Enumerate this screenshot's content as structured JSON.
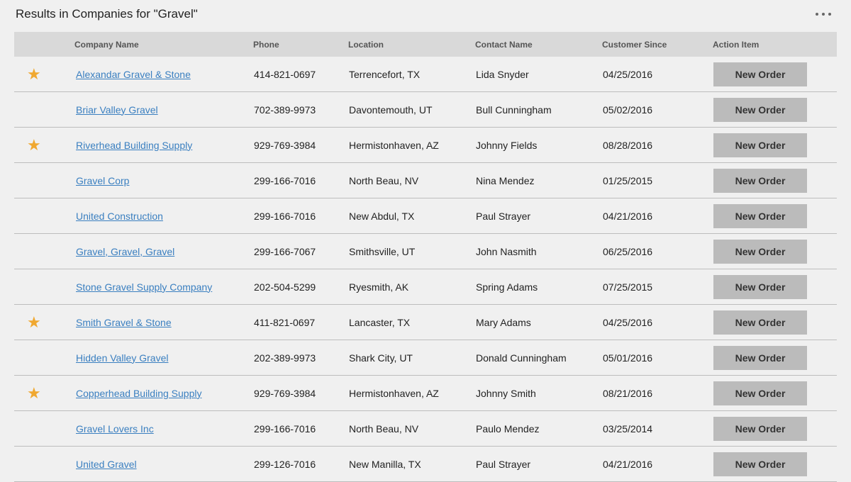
{
  "header": {
    "title": "Results in Companies for \"Gravel\""
  },
  "table": {
    "columns": [
      "",
      "Company Name",
      "Phone",
      "Location",
      "Contact Name",
      "Customer Since",
      "Action Item"
    ],
    "rows": [
      {
        "starred": true,
        "star": "★",
        "name": "Alexandar Gravel & Stone",
        "phone": "414-821-0697",
        "location": "Terrencefort, TX",
        "contact": "Lida Snyder",
        "since": "04/25/2016",
        "action": "New Order"
      },
      {
        "starred": false,
        "star": "",
        "name": "Briar Valley Gravel",
        "phone": "702-389-9973",
        "location": "Davontemouth, UT",
        "contact": "Bull Cunningham",
        "since": "05/02/2016",
        "action": "New Order"
      },
      {
        "starred": true,
        "star": "★",
        "name": "Riverhead Building Supply",
        "phone": "929-769-3984",
        "location": "Hermistonhaven, AZ",
        "contact": "Johnny Fields",
        "since": "08/28/2016",
        "action": "New Order"
      },
      {
        "starred": false,
        "star": "",
        "name": "Gravel Corp",
        "phone": "299-166-7016",
        "location": "North Beau, NV",
        "contact": "Nina Mendez",
        "since": "01/25/2015",
        "action": "New Order"
      },
      {
        "starred": false,
        "star": "",
        "name": "United Construction",
        "phone": "299-166-7016",
        "location": "New Abdul, TX",
        "contact": "Paul Strayer",
        "since": "04/21/2016",
        "action": "New Order"
      },
      {
        "starred": false,
        "star": "",
        "name": "Gravel, Gravel, Gravel",
        "phone": "299-166-7067",
        "location": "Smithsville, UT",
        "contact": "John Nasmith",
        "since": "06/25/2016",
        "action": "New Order"
      },
      {
        "starred": false,
        "star": "",
        "name": "Stone Gravel Supply Company",
        "phone": "202-504-5299",
        "location": "Ryesmith, AK",
        "contact": "Spring Adams",
        "since": "07/25/2015",
        "action": "New Order"
      },
      {
        "starred": true,
        "star": "★",
        "name": "Smith Gravel & Stone",
        "phone": "411-821-0697",
        "location": "Lancaster, TX",
        "contact": "Mary Adams",
        "since": "04/25/2016",
        "action": "New Order"
      },
      {
        "starred": false,
        "star": "",
        "name": "Hidden Valley Gravel",
        "phone": "202-389-9973",
        "location": "Shark City, UT",
        "contact": "Donald Cunningham",
        "since": "05/01/2016",
        "action": "New Order"
      },
      {
        "starred": true,
        "star": "★",
        "name": "Copperhead Building Supply",
        "phone": "929-769-3984",
        "location": "Hermistonhaven, AZ",
        "contact": "Johnny Smith",
        "since": "08/21/2016",
        "action": "New Order"
      },
      {
        "starred": false,
        "star": "",
        "name": "Gravel Lovers Inc",
        "phone": "299-166-7016",
        "location": "North Beau, NV",
        "contact": "Paulo Mendez",
        "since": "03/25/2014",
        "action": "New Order"
      },
      {
        "starred": false,
        "star": "",
        "name": "United Gravel",
        "phone": "299-126-7016",
        "location": "New Manilla, TX",
        "contact": "Paul Strayer",
        "since": "04/21/2016",
        "action": "New Order"
      }
    ]
  },
  "colors": {
    "star": "#f0a830",
    "link": "#3a7fc0",
    "header_bg": "#d9d9d9",
    "button_bg": "#bbbbbb"
  },
  "icons": {
    "more": "more-options-icon",
    "star": "star-icon"
  }
}
